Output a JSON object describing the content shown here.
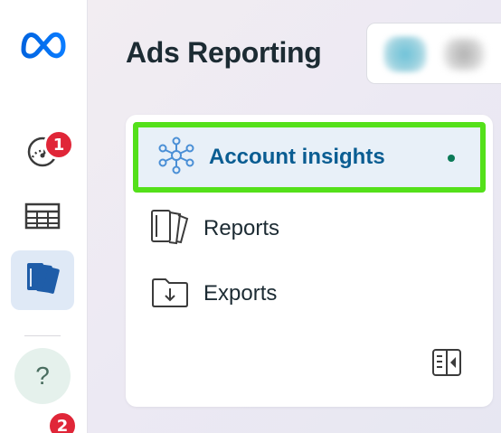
{
  "rail": {
    "logo_icon": "meta-logo-icon",
    "items": [
      {
        "name": "dashboard",
        "icon": "gauge-icon",
        "badge": "1"
      },
      {
        "name": "table",
        "icon": "table-icon"
      },
      {
        "name": "reporting",
        "icon": "reports-stack-icon",
        "active": true
      }
    ],
    "help_label": "?",
    "bottom_badge": "2"
  },
  "header": {
    "title": "Ads Reporting"
  },
  "panel": {
    "items": [
      {
        "label": "Account insights",
        "icon": "network-nodes-icon",
        "selected": true
      },
      {
        "label": "Reports",
        "icon": "document-stack-icon"
      },
      {
        "label": "Exports",
        "icon": "folder-download-icon"
      }
    ]
  },
  "colors": {
    "brand_blue": "#0a5d92",
    "selection_outline": "#54e01a",
    "badge_red": "#e02638",
    "status_dot": "#0b7a57"
  }
}
